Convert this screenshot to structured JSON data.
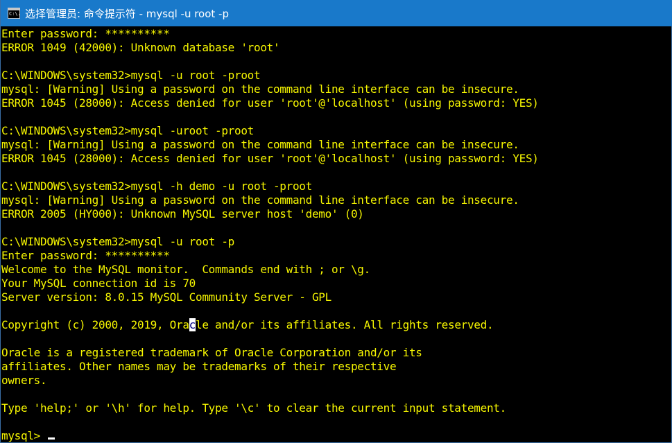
{
  "window": {
    "title": "选择管理员: 命令提示符 - mysql  -u root -p",
    "icon": "cmd-icon",
    "icon_text": "C:\\."
  },
  "console": {
    "text_color": "#f7f700",
    "background_color": "#000000",
    "lines": [
      "Enter password: **********",
      "ERROR 1049 (42000): Unknown database 'root'",
      "",
      "C:\\WINDOWS\\system32>mysql -u root -proot",
      "mysql: [Warning] Using a password on the command line interface can be insecure.",
      "ERROR 1045 (28000): Access denied for user 'root'@'localhost' (using password: YES)",
      "",
      "C:\\WINDOWS\\system32>mysql -uroot -proot",
      "mysql: [Warning] Using a password on the command line interface can be insecure.",
      "ERROR 1045 (28000): Access denied for user 'root'@'localhost' (using password: YES)",
      "",
      "C:\\WINDOWS\\system32>mysql -h demo -u root -proot",
      "mysql: [Warning] Using a password on the command line interface can be insecure.",
      "ERROR 2005 (HY000): Unknown MySQL server host 'demo' (0)",
      "",
      "C:\\WINDOWS\\system32>mysql -u root -p",
      "Enter password: **********",
      "Welcome to the MySQL monitor.  Commands end with ; or \\g.",
      "Your MySQL connection id is 70",
      "Server version: 8.0.15 MySQL Community Server - GPL",
      ""
    ],
    "copyright_line": {
      "before": "Copyright (c) 2000, 2019, Ora",
      "selected": "c",
      "after": "le and/or its affiliates. All rights reserved."
    },
    "trailing_lines": [
      "",
      "Oracle is a registered trademark of Oracle Corporation and/or its",
      "affiliates. Other names may be trademarks of their respective",
      "owners.",
      "",
      "Type 'help;' or '\\h' for help. Type '\\c' to clear the current input statement.",
      ""
    ],
    "prompt": "mysql> "
  }
}
